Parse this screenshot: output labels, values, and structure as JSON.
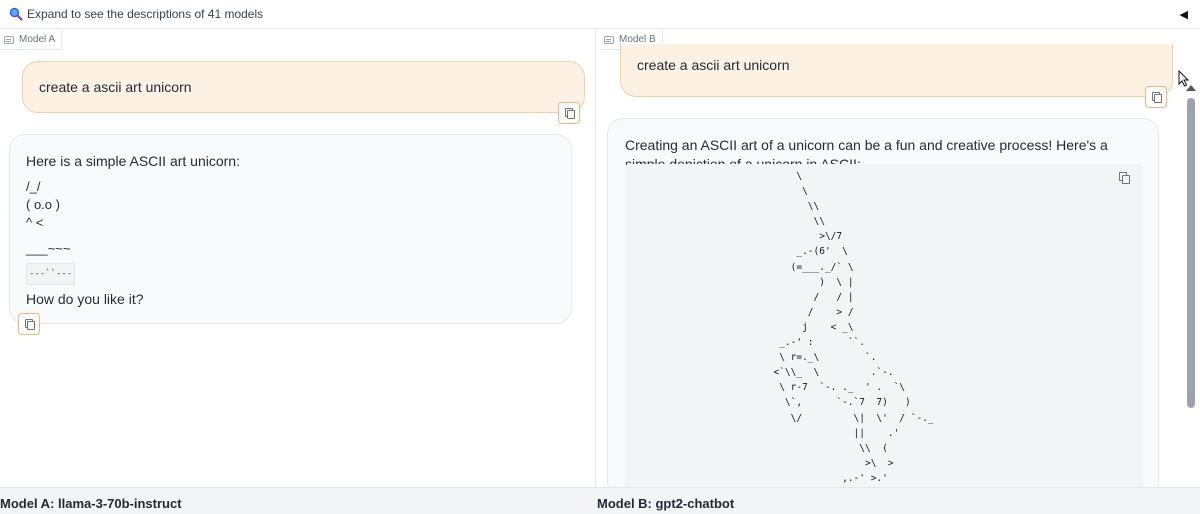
{
  "header": {
    "expand_label": "Expand to see the descriptions of 41 models",
    "collapse_glyph": "◀"
  },
  "model_a": {
    "pane_label": "Model A",
    "user_message": "create a ascii art unicorn",
    "response_intro": "Here is a simple ASCII art unicorn:",
    "ascii_lines": [
      "/_/",
      "( o.o )",
      "^ <",
      "___~~~"
    ],
    "inline_code": "---``---",
    "response_outro": "How do you like it?"
  },
  "model_b": {
    "pane_label": "Model B",
    "user_message": "create a ascii art unicorn",
    "response_intro": "Creating an ASCII art of a unicorn can be a fun and creative process! Here's a simple depiction of a unicorn in ASCII:",
    "code_art": "             \\\n              \\\n               \\\\\n                \\\\\n                 >\\/7\n             _.-(6'  \\\n            (=___._/` \\\n                 )  \\ |\n                /   / |\n               /    > /\n              j    < _\\\n          _.-' :      ``.\n          \\ r=._\\        `.\n         <`\\\\_  \\         .`-.\n          \\ r-7  `-. ._  ' .  `\\\n           \\`,      `-.`7  7)   )\n            \\/         \\|  \\'  / `-._\n                       ||    .'\n                        \\\\  (\n                         >\\  >\n                     ,.-' >.'"
  },
  "footer": {
    "model_a_name": "Model A: llama-3-70b-instruct",
    "model_b_name": "Model B: gpt2-chatbot"
  }
}
